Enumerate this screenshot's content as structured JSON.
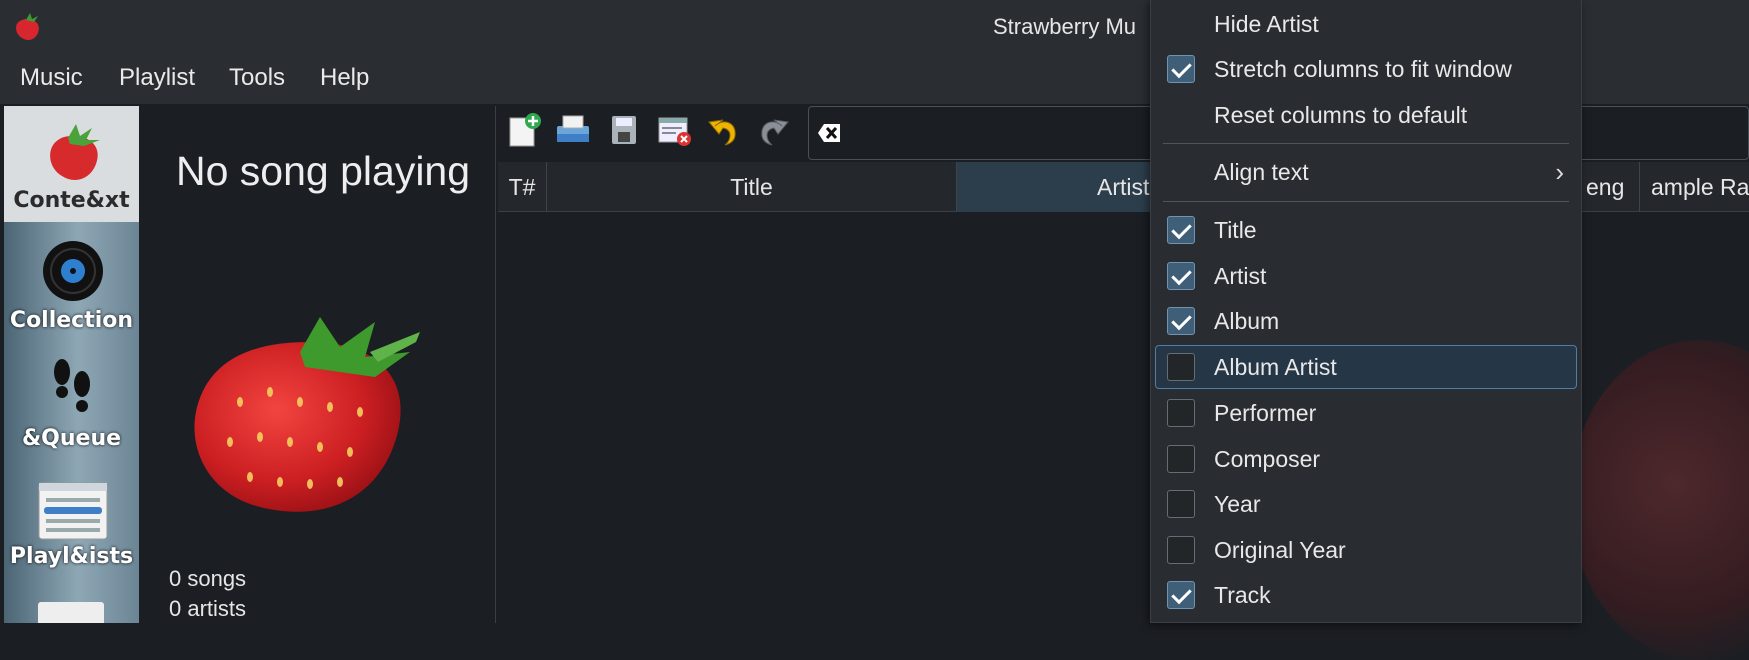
{
  "window": {
    "title": "Strawberry Mu"
  },
  "menubar": {
    "items": [
      "Music",
      "Playlist",
      "Tools",
      "Help"
    ]
  },
  "sidebar": {
    "items": [
      {
        "label": "Conte&xt",
        "icon": "strawberry-icon"
      },
      {
        "label": "Collection",
        "icon": "vinyl-icon"
      },
      {
        "label": "&Queue",
        "icon": "footprints-icon"
      },
      {
        "label": "Playl&ists",
        "icon": "playlist-icon"
      }
    ]
  },
  "context": {
    "now_playing": "No song playing",
    "songs": "0 songs",
    "artists": "0 artists"
  },
  "toolbar": {
    "icons": [
      "new-playlist-icon",
      "load-playlist-icon",
      "save-playlist-icon",
      "clear-playlist-icon",
      "undo-icon",
      "redo-icon"
    ],
    "clear_filter_icon": "clear-filter-icon"
  },
  "playlist": {
    "columns": [
      "T#",
      "Title",
      "Artist",
      "eng",
      "ample Ra"
    ]
  },
  "context_menu": {
    "hide_artist": "Hide Artist",
    "stretch": "Stretch columns to fit window",
    "reset": "Reset columns to default",
    "align": "Align text",
    "columns": [
      {
        "label": "Title",
        "checked": true
      },
      {
        "label": "Artist",
        "checked": true
      },
      {
        "label": "Album",
        "checked": true
      },
      {
        "label": "Album Artist",
        "checked": false
      },
      {
        "label": "Performer",
        "checked": false
      },
      {
        "label": "Composer",
        "checked": false
      },
      {
        "label": "Year",
        "checked": false
      },
      {
        "label": "Original Year",
        "checked": false
      },
      {
        "label": "Track",
        "checked": true
      }
    ]
  },
  "colors": {
    "accent": "#4d7fa6",
    "menu_bg": "#292c31",
    "window_bg": "#1b1e23"
  }
}
